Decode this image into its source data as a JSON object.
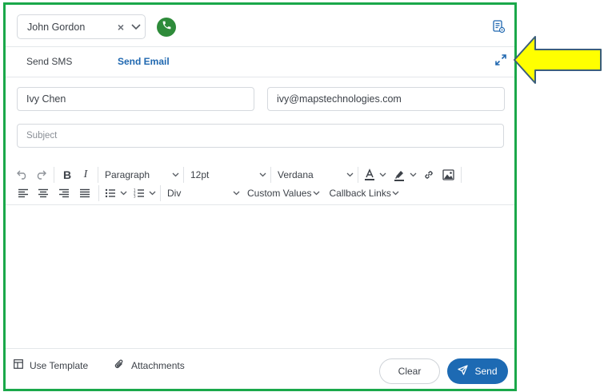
{
  "header": {
    "contact_name": "John Gordon",
    "clear_symbol": "×",
    "icons": [
      "chevron-down-icon",
      "phone-icon",
      "document-settings-icon"
    ]
  },
  "tabs": [
    {
      "label": "Send SMS",
      "active": false
    },
    {
      "label": "Send Email",
      "active": true
    }
  ],
  "form": {
    "from_name": "Ivy Chen",
    "to_email": "ivy@mapstechnologies.com",
    "subject_placeholder": "Subject"
  },
  "toolbar": {
    "paragraph": "Paragraph",
    "font_size": "12pt",
    "font_family": "Verdana",
    "block": "Div",
    "custom_values": "Custom Values",
    "callback_links": "Callback Links"
  },
  "footer": {
    "use_template": "Use Template",
    "attachments": "Attachments",
    "clear": "Clear",
    "send": "Send"
  },
  "colors": {
    "frame": "#1aa84a",
    "accent": "#1d6ab3",
    "tab_active": "#2068b0",
    "call": "#2e8b3a",
    "callout": "#ffff00"
  }
}
